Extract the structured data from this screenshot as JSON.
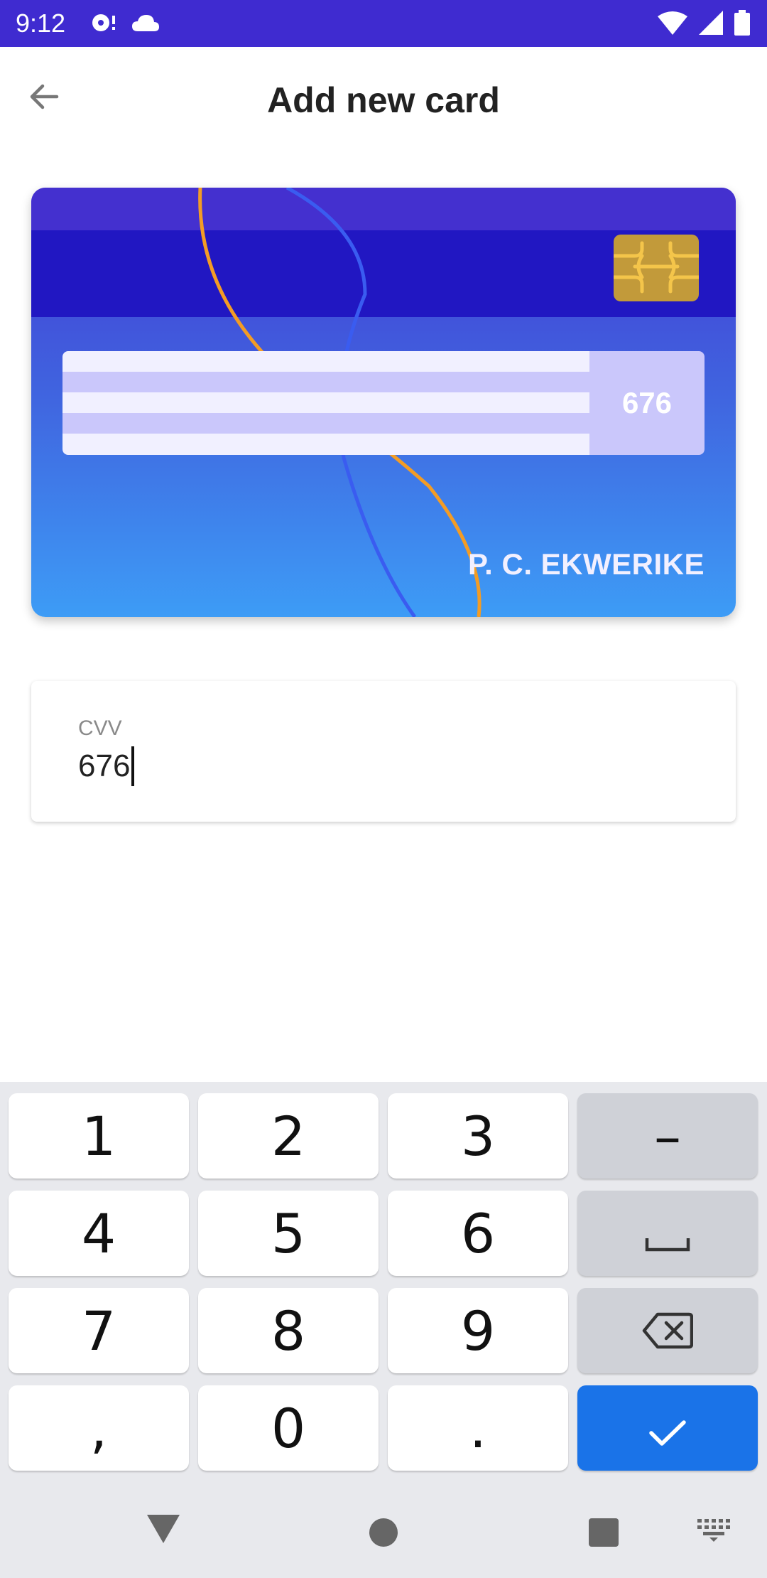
{
  "status_bar": {
    "time": "9:12",
    "background": "#3f2bd0",
    "left_icons": [
      "media-icon",
      "cloud-icon"
    ],
    "right_icons": [
      "wifi-icon",
      "signal-icon",
      "battery-icon"
    ]
  },
  "app_bar": {
    "title": "Add new card",
    "back_icon": "arrow-back-icon"
  },
  "card": {
    "cvv": "676",
    "holder": "P. C. EKWERIKE",
    "colors": {
      "top": "#4338d2",
      "bottom": "#3d9cf6",
      "stripe": "#2117c2",
      "chip": "#c29a3a",
      "wave_orange": "#f39c25",
      "wave_blue": "#3a5cf0"
    }
  },
  "cvv_field": {
    "label": "CVV",
    "value": "676"
  },
  "keyboard": {
    "rows": [
      [
        "1",
        "2",
        "3",
        "–"
      ],
      [
        "4",
        "5",
        "6",
        "space-icon"
      ],
      [
        "7",
        "8",
        "9",
        "backspace-icon"
      ],
      [
        ",",
        "0",
        ".",
        "check-icon"
      ]
    ],
    "accent": "#1a73e8"
  },
  "nav_bar": {
    "buttons": [
      "back-triangle-icon",
      "home-circle-icon",
      "recents-square-icon",
      "keyboard-switch-icon"
    ]
  }
}
